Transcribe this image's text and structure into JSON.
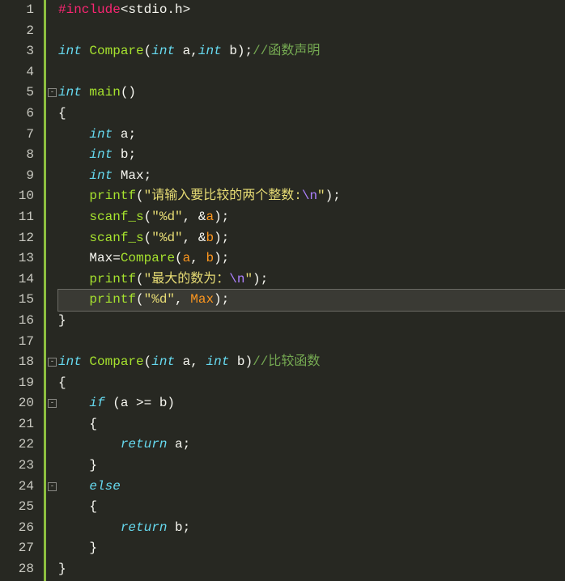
{
  "editor": {
    "language": "c",
    "highlighted_line": 15,
    "line_count": 28,
    "fold_markers": [
      {
        "line": 5,
        "state": "-"
      },
      {
        "line": 18,
        "state": "-"
      },
      {
        "line": 20,
        "state": "-"
      },
      {
        "line": 24,
        "state": "-"
      }
    ],
    "lines": [
      {
        "n": 1,
        "tokens": [
          [
            "pre",
            "#include"
          ],
          [
            "op",
            "<"
          ],
          [
            "ident",
            "stdio.h"
          ],
          [
            "op",
            ">"
          ]
        ]
      },
      {
        "n": 2,
        "tokens": []
      },
      {
        "n": 3,
        "tokens": [
          [
            "type",
            "int"
          ],
          [
            "op",
            " "
          ],
          [
            "fn",
            "Compare"
          ],
          [
            "op",
            "("
          ],
          [
            "type",
            "int"
          ],
          [
            "op",
            " "
          ],
          [
            "ident",
            "a"
          ],
          [
            "op",
            ","
          ],
          [
            "type",
            "int"
          ],
          [
            "op",
            " "
          ],
          [
            "ident",
            "b"
          ],
          [
            "op",
            ");"
          ],
          [
            "com",
            "//函数声明"
          ]
        ]
      },
      {
        "n": 4,
        "tokens": []
      },
      {
        "n": 5,
        "tokens": [
          [
            "type",
            "int"
          ],
          [
            "op",
            " "
          ],
          [
            "fn",
            "main"
          ],
          [
            "op",
            "()"
          ]
        ]
      },
      {
        "n": 6,
        "tokens": [
          [
            "op",
            "{"
          ]
        ]
      },
      {
        "n": 7,
        "tokens": [
          [
            "op",
            "    "
          ],
          [
            "type",
            "int"
          ],
          [
            "op",
            " "
          ],
          [
            "ident",
            "a"
          ],
          [
            "op",
            ";"
          ]
        ]
      },
      {
        "n": 8,
        "tokens": [
          [
            "op",
            "    "
          ],
          [
            "type",
            "int"
          ],
          [
            "op",
            " "
          ],
          [
            "ident",
            "b"
          ],
          [
            "op",
            ";"
          ]
        ]
      },
      {
        "n": 9,
        "tokens": [
          [
            "op",
            "    "
          ],
          [
            "type",
            "int"
          ],
          [
            "op",
            " "
          ],
          [
            "ident",
            "Max"
          ],
          [
            "op",
            ";"
          ]
        ]
      },
      {
        "n": 10,
        "tokens": [
          [
            "op",
            "    "
          ],
          [
            "fn",
            "printf"
          ],
          [
            "op",
            "("
          ],
          [
            "str",
            "\"请输入要比较的两个整数:"
          ],
          [
            "esc",
            "\\n"
          ],
          [
            "str",
            "\""
          ],
          [
            "op",
            ");"
          ]
        ]
      },
      {
        "n": 11,
        "tokens": [
          [
            "op",
            "    "
          ],
          [
            "fn",
            "scanf_s"
          ],
          [
            "op",
            "("
          ],
          [
            "str",
            "\"%d\""
          ],
          [
            "op",
            ", &"
          ],
          [
            "var",
            "a"
          ],
          [
            "op",
            ");"
          ]
        ]
      },
      {
        "n": 12,
        "tokens": [
          [
            "op",
            "    "
          ],
          [
            "fn",
            "scanf_s"
          ],
          [
            "op",
            "("
          ],
          [
            "str",
            "\"%d\""
          ],
          [
            "op",
            ", &"
          ],
          [
            "var",
            "b"
          ],
          [
            "op",
            ");"
          ]
        ]
      },
      {
        "n": 13,
        "tokens": [
          [
            "op",
            "    "
          ],
          [
            "ident",
            "Max"
          ],
          [
            "op",
            "="
          ],
          [
            "fn",
            "Compare"
          ],
          [
            "op",
            "("
          ],
          [
            "var",
            "a"
          ],
          [
            "op",
            ", "
          ],
          [
            "var",
            "b"
          ],
          [
            "op",
            ");"
          ]
        ]
      },
      {
        "n": 14,
        "tokens": [
          [
            "op",
            "    "
          ],
          [
            "fn",
            "printf"
          ],
          [
            "op",
            "("
          ],
          [
            "str",
            "\"最大的数为："
          ],
          [
            "esc",
            "\\n"
          ],
          [
            "str",
            "\""
          ],
          [
            "op",
            ");"
          ]
        ]
      },
      {
        "n": 15,
        "tokens": [
          [
            "op",
            "    "
          ],
          [
            "fn",
            "printf"
          ],
          [
            "op",
            "("
          ],
          [
            "str",
            "\"%d\""
          ],
          [
            "op",
            ", "
          ],
          [
            "var",
            "Max"
          ],
          [
            "op",
            ");"
          ]
        ]
      },
      {
        "n": 16,
        "tokens": [
          [
            "op",
            "}"
          ]
        ]
      },
      {
        "n": 17,
        "tokens": []
      },
      {
        "n": 18,
        "tokens": [
          [
            "type",
            "int"
          ],
          [
            "op",
            " "
          ],
          [
            "fn",
            "Compare"
          ],
          [
            "op",
            "("
          ],
          [
            "type",
            "int"
          ],
          [
            "op",
            " "
          ],
          [
            "ident",
            "a"
          ],
          [
            "op",
            ", "
          ],
          [
            "type",
            "int"
          ],
          [
            "op",
            " "
          ],
          [
            "ident",
            "b"
          ],
          [
            "op",
            ")"
          ],
          [
            "com",
            "//比较函数"
          ]
        ]
      },
      {
        "n": 19,
        "tokens": [
          [
            "op",
            "{"
          ]
        ]
      },
      {
        "n": 20,
        "tokens": [
          [
            "op",
            "    "
          ],
          [
            "kw",
            "if"
          ],
          [
            "op",
            " (a >= b)"
          ]
        ]
      },
      {
        "n": 21,
        "tokens": [
          [
            "op",
            "    {"
          ]
        ]
      },
      {
        "n": 22,
        "tokens": [
          [
            "op",
            "        "
          ],
          [
            "kw",
            "return"
          ],
          [
            "op",
            " a;"
          ]
        ]
      },
      {
        "n": 23,
        "tokens": [
          [
            "op",
            "    }"
          ]
        ]
      },
      {
        "n": 24,
        "tokens": [
          [
            "op",
            "    "
          ],
          [
            "kw",
            "else"
          ]
        ]
      },
      {
        "n": 25,
        "tokens": [
          [
            "op",
            "    {"
          ]
        ]
      },
      {
        "n": 26,
        "tokens": [
          [
            "op",
            "        "
          ],
          [
            "kw",
            "return"
          ],
          [
            "op",
            " b;"
          ]
        ]
      },
      {
        "n": 27,
        "tokens": [
          [
            "op",
            "    }"
          ]
        ]
      },
      {
        "n": 28,
        "tokens": [
          [
            "op",
            "}"
          ]
        ]
      }
    ]
  }
}
